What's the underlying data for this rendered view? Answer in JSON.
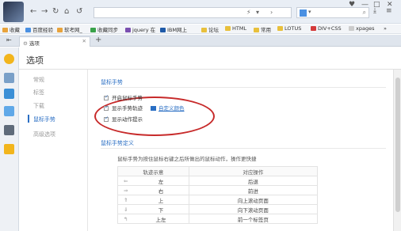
{
  "browser": {
    "address_nav": [
      "⚡",
      "▾",
      "›"
    ],
    "search_dropdown": "▾",
    "window_controls": [
      "♥",
      "—",
      "□",
      "✕"
    ]
  },
  "bookmarks": [
    {
      "label": "收藏",
      "color": "#e8a33c"
    },
    {
      "label": "百度经验",
      "color": "#4a90e2"
    },
    {
      "label": "软考网_",
      "color": "#e8a33c"
    },
    {
      "label": "收藏同步",
      "color": "#3aa24a"
    },
    {
      "label": "jquery 在",
      "color": "#7a4fb0"
    },
    {
      "label": "IBM网上",
      "color": "#1f5aa8"
    },
    {
      "label": "论坛",
      "color": "#e8c03c"
    },
    {
      "label": "HTML",
      "color": "#e8c03c"
    },
    {
      "label": "常用",
      "color": "#e8c03c"
    },
    {
      "label": "LOTUS",
      "color": "#e8c03c"
    },
    {
      "label": "DIV+CSS",
      "color": "#d43a3a"
    },
    {
      "label": "xpages",
      "color": "#cccccc"
    },
    {
      "label": "»",
      "color": "transparent"
    }
  ],
  "tab": {
    "label": "选项"
  },
  "page": {
    "title": "选项"
  },
  "nav": [
    {
      "label": "常规",
      "active": false
    },
    {
      "label": "标签",
      "active": false
    },
    {
      "label": "下载",
      "active": false
    },
    {
      "label": "鼠标手势",
      "active": true
    },
    {
      "label": "高级选项",
      "active": false
    }
  ],
  "gesture_section": {
    "title": "鼠标手势",
    "options": [
      {
        "label": "开启鼠标手势",
        "checked": true
      },
      {
        "label": "显示手势轨迹",
        "checked": true
      },
      {
        "label": "显示动作提示",
        "checked": true
      }
    ],
    "custom_color_link": "自定义颜色",
    "accent_color": "#2b6fc4",
    "highlight_color": "#c72a2a"
  },
  "definition_section": {
    "title": "鼠标手势定义",
    "description": "鼠标手势为按住鼠标右键之后所做出的鼠标动作，操作更快捷",
    "table": {
      "headers": [
        "轨迹示意",
        "对应操作"
      ],
      "rows": [
        {
          "icon": "⇐",
          "track": "左",
          "action": "后退"
        },
        {
          "icon": "⇒",
          "track": "右",
          "action": "前进"
        },
        {
          "icon": "⇑",
          "track": "上",
          "action": "向上滚动页面"
        },
        {
          "icon": "⇓",
          "track": "下",
          "action": "向下滚动页面"
        },
        {
          "icon": "↰",
          "track": "上左",
          "action": "前一个标签页"
        }
      ]
    }
  }
}
